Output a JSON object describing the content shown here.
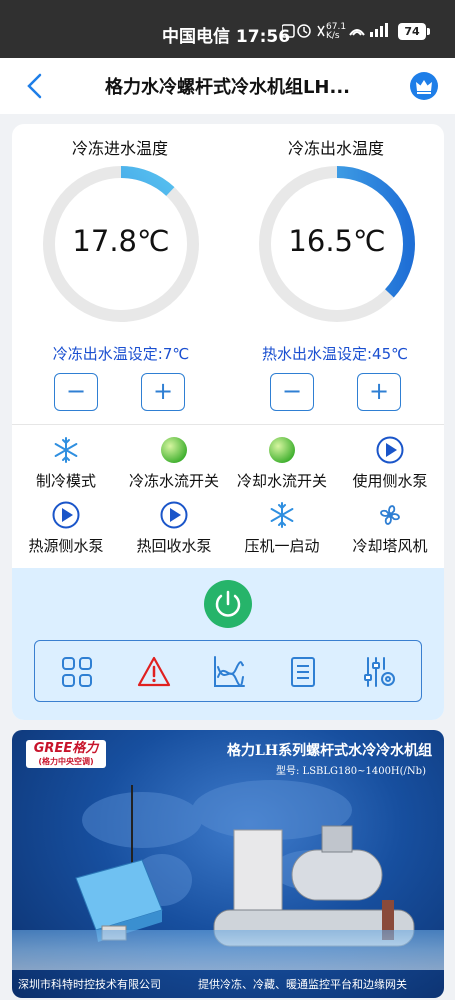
{
  "status_bar": {
    "carrier_time": "中国电信 17:56",
    "net_speed": "67.1 K/s",
    "battery": "74"
  },
  "header": {
    "title": "格力水冷螺杆式冷水机组LH...",
    "crown_icon": "crown-icon"
  },
  "gauges": [
    {
      "label": "冷冻进水温度",
      "value": "17.8℃",
      "fill_fraction": 0.12
    },
    {
      "label": "冷冻出水温度",
      "value": "16.5℃",
      "fill_fraction": 0.37
    }
  ],
  "setpoints": [
    {
      "label": "冷冻出水温设定:7℃"
    },
    {
      "label": "热水出水温设定:45℃"
    }
  ],
  "stepper_labels": {
    "minus": "−",
    "plus": "+"
  },
  "status_items": [
    {
      "label": "制冷模式",
      "icon": "snowflake-icon"
    },
    {
      "label": "冷冻水流开关",
      "icon": "green-indicator-icon"
    },
    {
      "label": "冷却水流开关",
      "icon": "green-indicator-icon"
    },
    {
      "label": "使用侧水泵",
      "icon": "pump-play-icon"
    },
    {
      "label": "热源侧水泵",
      "icon": "pump-play-icon"
    },
    {
      "label": "热回收水泵",
      "icon": "pump-play-icon"
    },
    {
      "label": "压机一启动",
      "icon": "snowflake-icon"
    },
    {
      "label": "冷却塔风机",
      "icon": "fan-icon"
    }
  ],
  "toolbar": {
    "icons": [
      "grid-icon",
      "warning-icon",
      "chart-icon",
      "list-icon",
      "settings-sliders-icon"
    ]
  },
  "banner": {
    "logo_text": "GREE格力",
    "logo_sub": "(格力中央空调)",
    "title": "格力LH系列螺杆式水冷冷水机组",
    "model": "型号: LSBLG180~1400H(/Nb)",
    "footer_left": "深圳市科特时控技术有限公司",
    "footer_right": "提供冷冻、冷藏、暖通监控平台和边缘网关"
  },
  "colors": {
    "accent": "#1a4fd0",
    "gauge_arc": "#2f8fe0",
    "gauge_track": "#e8e8e8",
    "indicator_green": "#4cc23a",
    "power_green": "#26b46a",
    "panel_bg": "#dcefff"
  }
}
